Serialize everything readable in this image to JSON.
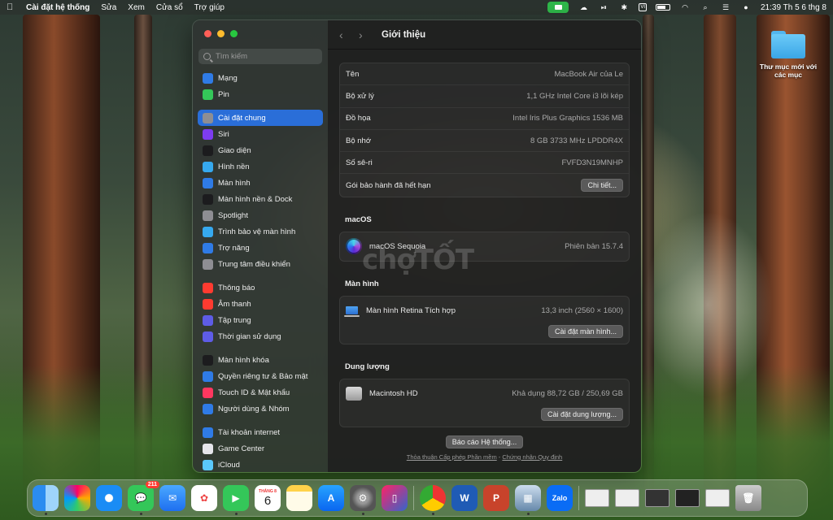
{
  "menubar": {
    "app_name": "Cài đặt hệ thống",
    "menus": [
      "Sửa",
      "Xem",
      "Cửa sổ",
      "Trợ giúp"
    ],
    "input_source": "VI",
    "clock": "21:39 Th 5 6 thg 8"
  },
  "desktop": {
    "folder_label": "Thư mục mới với các mục"
  },
  "sidebar": {
    "search_placeholder": "Tìm kiếm",
    "groups": [
      [
        {
          "label": "Mạng",
          "icon": "globe-icon",
          "color": "#2f7be6"
        },
        {
          "label": "Pin",
          "icon": "battery-icon",
          "color": "#34c759"
        }
      ],
      [
        {
          "label": "Cài đặt chung",
          "icon": "gear-icon",
          "color": "#8e8e93",
          "active": true
        },
        {
          "label": "Siri",
          "icon": "siri-icon",
          "color": "#7d3cf0"
        },
        {
          "label": "Giao diện",
          "icon": "appearance-icon",
          "color": "#1c1c1e"
        },
        {
          "label": "Hình nền",
          "icon": "wallpaper-icon",
          "color": "#36a9ef"
        },
        {
          "label": "Màn hình",
          "icon": "display-icon",
          "color": "#2f7be6"
        },
        {
          "label": "Màn hình nền & Dock",
          "icon": "dock-icon",
          "color": "#1c1c1e"
        },
        {
          "label": "Spotlight",
          "icon": "spotlight-icon",
          "color": "#8e8e93"
        },
        {
          "label": "Trình bảo vệ màn hình",
          "icon": "screensaver-icon",
          "color": "#36a9ef"
        },
        {
          "label": "Trợ năng",
          "icon": "accessibility-icon",
          "color": "#2f7be6"
        },
        {
          "label": "Trung tâm điều khiển",
          "icon": "control-center-icon",
          "color": "#8e8e93"
        }
      ],
      [
        {
          "label": "Thông báo",
          "icon": "notifications-icon",
          "color": "#ff3b30"
        },
        {
          "label": "Âm thanh",
          "icon": "sound-icon",
          "color": "#ff3b30"
        },
        {
          "label": "Tập trung",
          "icon": "focus-icon",
          "color": "#5e5ce6"
        },
        {
          "label": "Thời gian sử dụng",
          "icon": "screen-time-icon",
          "color": "#5e5ce6"
        }
      ],
      [
        {
          "label": "Màn hình khóa",
          "icon": "lock-screen-icon",
          "color": "#1c1c1e"
        },
        {
          "label": "Quyền riêng tư & Bảo mật",
          "icon": "privacy-icon",
          "color": "#2f7be6"
        },
        {
          "label": "Touch ID & Mật khẩu",
          "icon": "fingerprint-icon",
          "color": "#ff375f"
        },
        {
          "label": "Người dùng & Nhóm",
          "icon": "users-icon",
          "color": "#2f7be6"
        }
      ],
      [
        {
          "label": "Tài khoản internet",
          "icon": "at-icon",
          "color": "#2f7be6"
        },
        {
          "label": "Game Center",
          "icon": "game-center-icon",
          "color": "#e5e5ea"
        },
        {
          "label": "iCloud",
          "icon": "icloud-icon",
          "color": "#5ac8fa"
        }
      ]
    ]
  },
  "main": {
    "title": "Giới thiệu",
    "specs": [
      {
        "label": "Tên",
        "value": "MacBook Air của Le"
      },
      {
        "label": "Bộ xử lý",
        "value": "1,1 GHz Intel Core i3 lõi kép"
      },
      {
        "label": "Đồ họa",
        "value": "Intel Iris Plus Graphics 1536 MB"
      },
      {
        "label": "Bộ nhớ",
        "value": "8 GB 3733 MHz LPDDR4X"
      },
      {
        "label": "Số sê-ri",
        "value": "FVFD3N19MNHP"
      }
    ],
    "warranty_label": "Gói bảo hành đã hết hạn",
    "warranty_button": "Chi tiết...",
    "macos_section": "macOS",
    "macos_name": "macOS Sequoia",
    "macos_version": "Phiên bản 15.7.4",
    "display_section": "Màn hình",
    "display_name": "Màn hình Retina Tích hợp",
    "display_spec": "13,3 inch (2560 × 1600)",
    "display_button": "Cài đặt màn hình...",
    "storage_section": "Dung lượng",
    "storage_name": "Macintosh HD",
    "storage_value": "Khả dụng 88,72 GB / 250,69 GB",
    "storage_button": "Cài đặt dung lượng...",
    "report_button": "Báo cáo Hệ thống...",
    "footer_license": "Thỏa thuận Cấp phép Phần mềm",
    "footer_sep": "-",
    "footer_cert": "Chứng nhận Quy định"
  },
  "watermark": "chợTỐT",
  "dock": {
    "messages_badge": "211",
    "calendar_month": "THÁNG 8",
    "calendar_day": "6",
    "word_letter": "W",
    "ppt_letter": "P",
    "zalo_label": "Zalo"
  }
}
